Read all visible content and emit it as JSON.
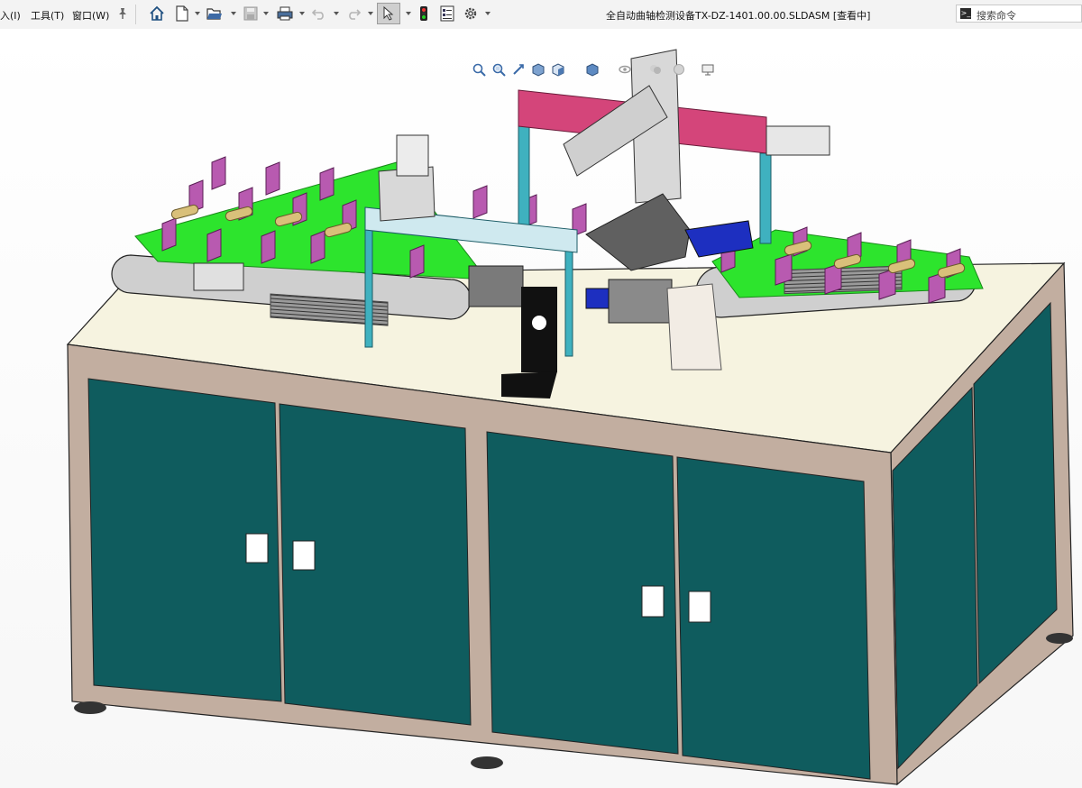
{
  "menubar": {
    "items": [
      {
        "label": "入(I)"
      },
      {
        "label": "工具(T)"
      },
      {
        "label": "窗口(W)"
      }
    ],
    "pin_icon": "pin-icon"
  },
  "toolbar": {
    "icons": [
      "home-icon",
      "new-document-icon",
      "open-folder-icon",
      "save-icon",
      "print-icon",
      "undo-icon",
      "redo-icon",
      "select-cursor-icon",
      "traffic-light-icon",
      "file-properties-icon",
      "options-gear-icon"
    ]
  },
  "window": {
    "title": "全自动曲轴检测设备TX-DZ-1401.00.00.SLDASM [查看中]"
  },
  "search": {
    "placeholder": "搜索命令"
  },
  "heads_up_toolbar": {
    "icons": [
      "zoom-to-fit-icon",
      "zoom-to-area-icon",
      "previous-view-icon",
      "section-view-icon",
      "view-orientation-icon",
      "display-style-icon",
      "hide-show-items-icon",
      "edit-appearance-icon",
      "apply-scene-icon",
      "view-settings-icon"
    ]
  },
  "colors": {
    "cabinet_frame": "#c2aea0",
    "cabinet_door": "#0f5c5e",
    "table_top": "#f6f3e0",
    "conveyor_belt": "#2de42d",
    "v_block": "#b85ab0",
    "gantry": "#3fb1bf",
    "gantry_beam": "#d4457a",
    "motor": "#1d2fc0"
  }
}
